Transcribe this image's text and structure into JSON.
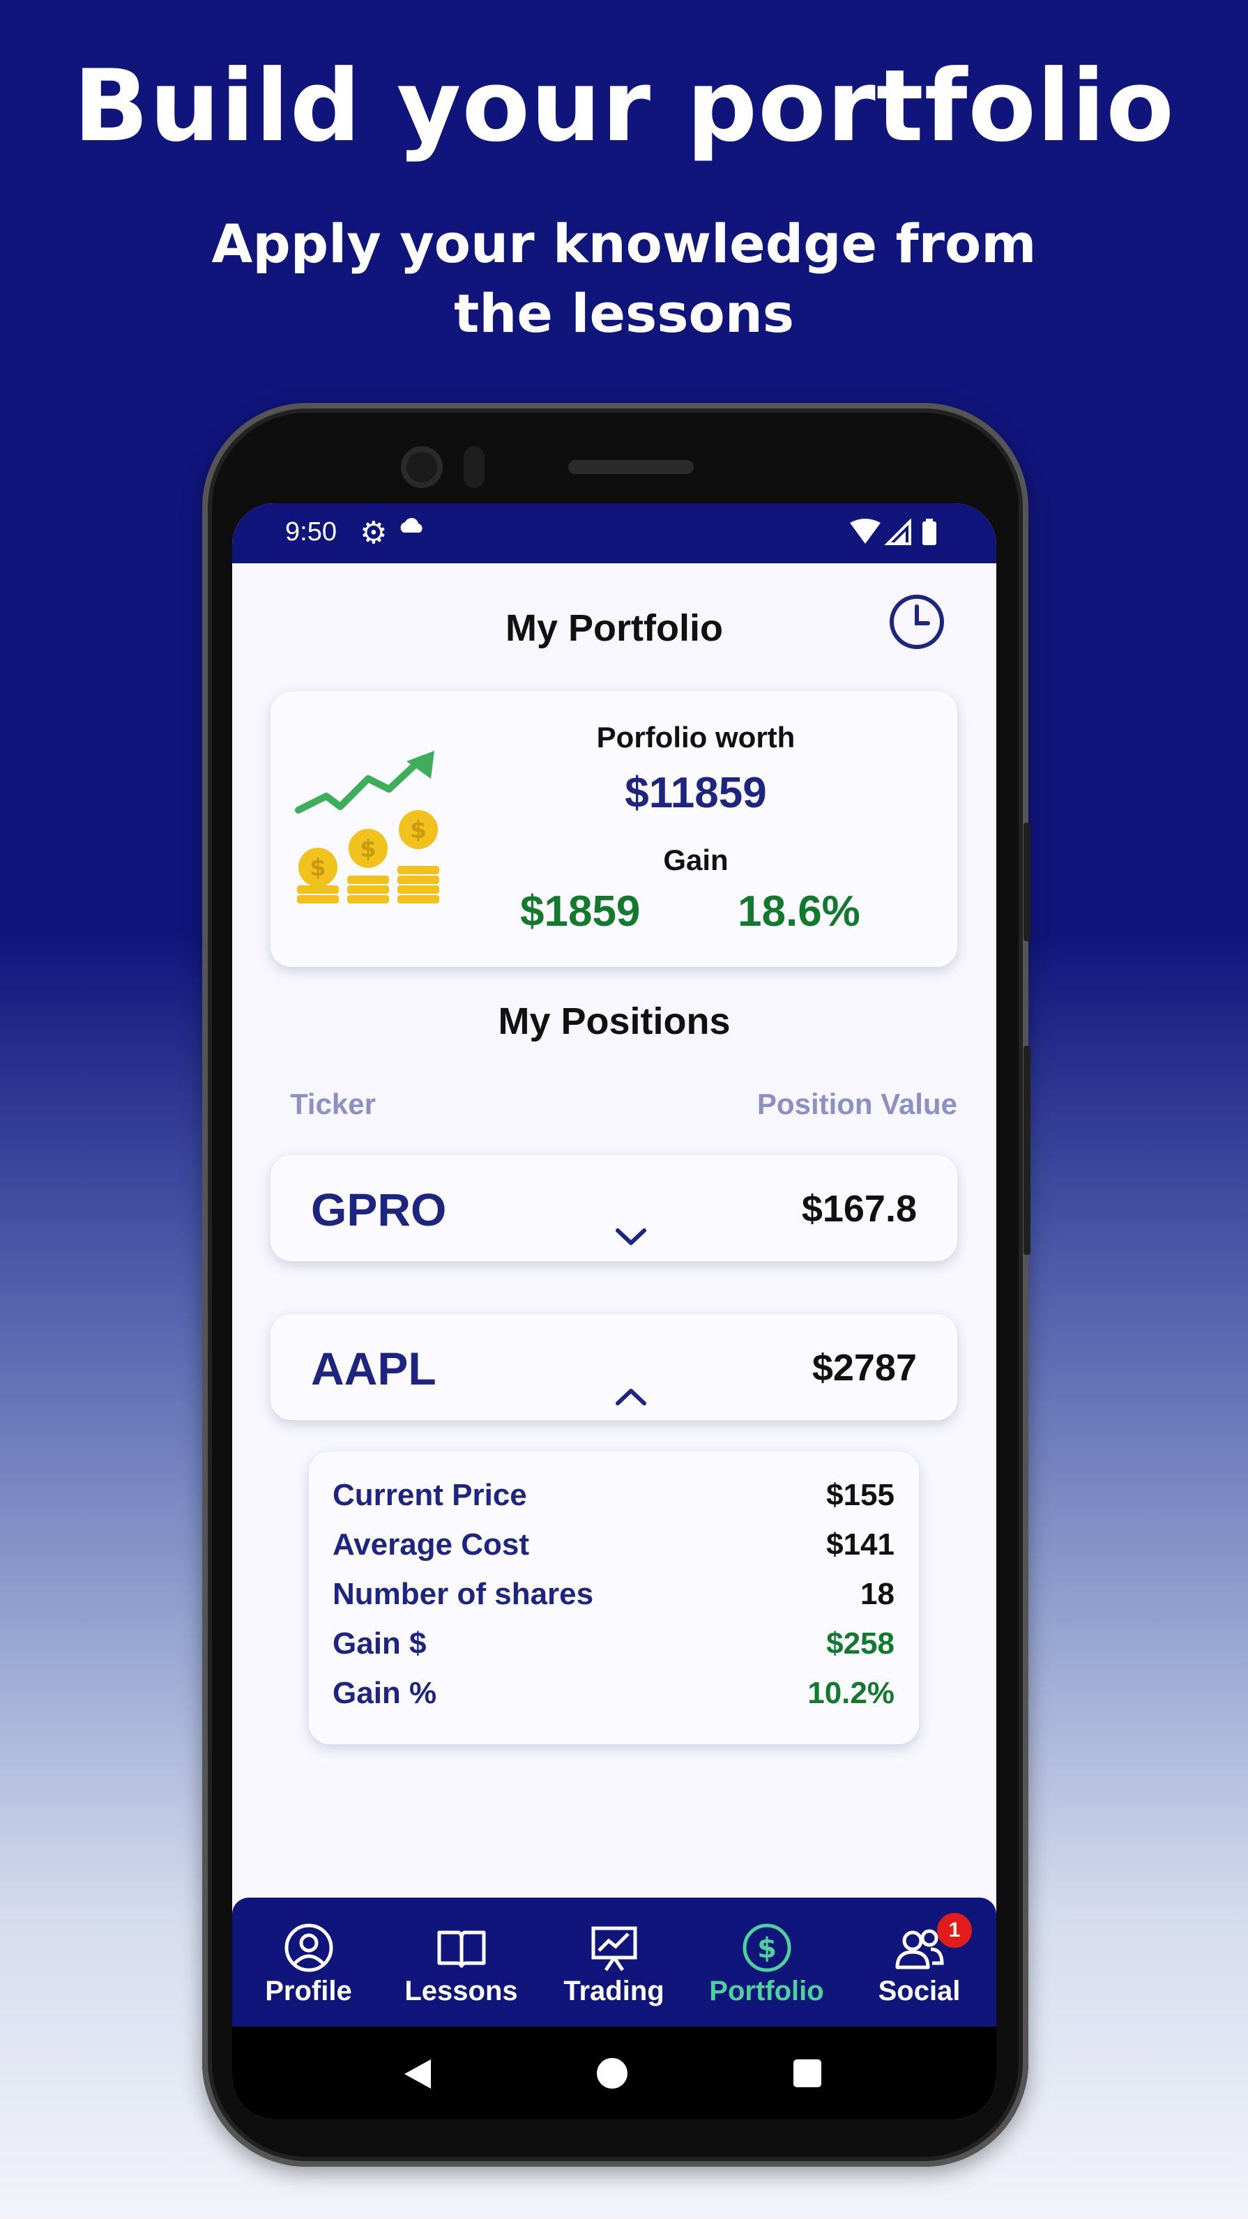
{
  "promo": {
    "headline": "Build your portfolio",
    "subheadline": "Apply your knowledge from the lessons"
  },
  "status_bar": {
    "time": "9:50"
  },
  "screen": {
    "title": "My Portfolio",
    "history_icon": "clock-icon"
  },
  "summary": {
    "worth_label": "Porfolio worth",
    "worth_value": "$11859",
    "gain_label": "Gain",
    "gain_value": "$1859",
    "gain_percent": "18.6%"
  },
  "positions": {
    "title": "My Positions",
    "col_ticker": "Ticker",
    "col_value": "Position Value",
    "items": [
      {
        "ticker": "GPRO",
        "value": "$167.8",
        "expanded": false
      },
      {
        "ticker": "AAPL",
        "value": "$2787",
        "expanded": true
      }
    ],
    "details": {
      "rows": [
        {
          "label": "Current Price",
          "value": "$155"
        },
        {
          "label": "Average Cost",
          "value": "$141"
        },
        {
          "label": "Number of shares",
          "value": "18"
        },
        {
          "label": "Gain $",
          "value": "$258"
        },
        {
          "label": "Gain %",
          "value": "10.2%"
        }
      ]
    }
  },
  "nav": {
    "items": [
      {
        "label": "Profile",
        "icon": "profile-icon"
      },
      {
        "label": "Lessons",
        "icon": "book-icon"
      },
      {
        "label": "Trading",
        "icon": "chart-board-icon"
      },
      {
        "label": "Portfolio",
        "icon": "dollar-icon",
        "active": true
      },
      {
        "label": "Social",
        "icon": "group-icon",
        "badge": "1"
      }
    ]
  },
  "colors": {
    "brand": "#10157c",
    "accent_green": "#127a2e",
    "nav_active": "#4fd19a",
    "muted": "#8d90c2"
  }
}
